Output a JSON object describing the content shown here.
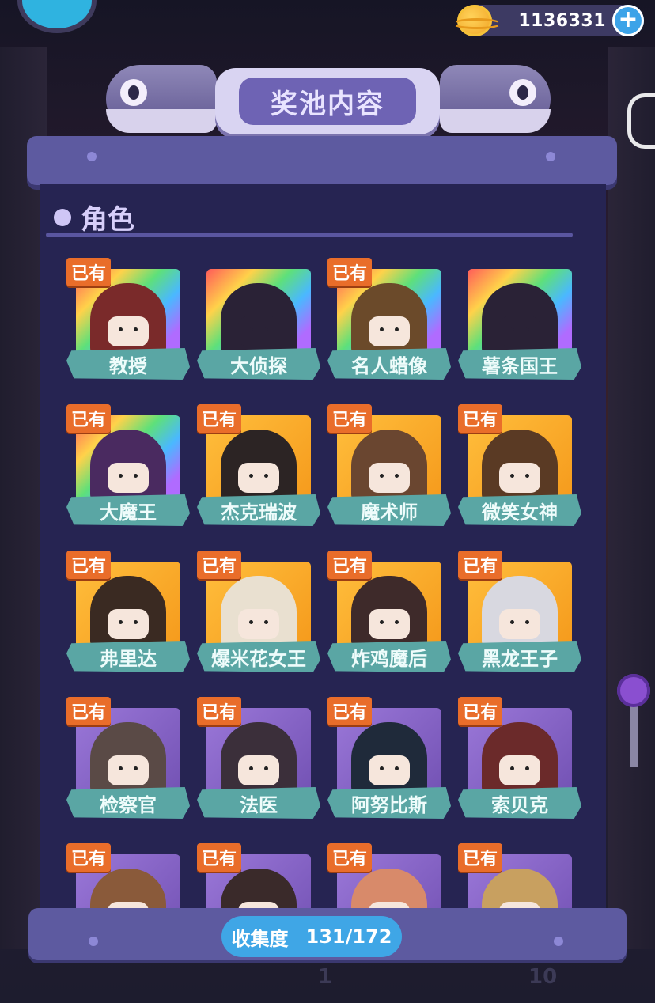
{
  "header": {
    "currency_value": "1136331",
    "plus_label": "+",
    "title": "奖池内容"
  },
  "section": {
    "title": "角色"
  },
  "owned_badge": "已有",
  "characters": [
    {
      "name": "教授",
      "rarity": "rainbow",
      "owned": true
    },
    {
      "name": "大侦探",
      "rarity": "rainbow",
      "owned": false
    },
    {
      "name": "名人蜡像",
      "rarity": "rainbow",
      "owned": true
    },
    {
      "name": "薯条国王",
      "rarity": "rainbow",
      "owned": false
    },
    {
      "name": "大魔王",
      "rarity": "rainbow",
      "owned": true
    },
    {
      "name": "杰克瑞波",
      "rarity": "gold",
      "owned": true
    },
    {
      "name": "魔术师",
      "rarity": "gold",
      "owned": true
    },
    {
      "name": "微笑女神",
      "rarity": "gold",
      "owned": true
    },
    {
      "name": "弗里达",
      "rarity": "gold",
      "owned": true
    },
    {
      "name": "爆米花女王",
      "rarity": "gold",
      "owned": true
    },
    {
      "name": "炸鸡魔后",
      "rarity": "gold",
      "owned": true
    },
    {
      "name": "黑龙王子",
      "rarity": "gold",
      "owned": true
    },
    {
      "name": "检察官",
      "rarity": "purple",
      "owned": true
    },
    {
      "name": "法医",
      "rarity": "purple",
      "owned": true
    },
    {
      "name": "阿努比斯",
      "rarity": "purple",
      "owned": true
    },
    {
      "name": "索贝克",
      "rarity": "purple",
      "owned": true
    },
    {
      "name": "",
      "rarity": "purple",
      "owned": true
    },
    {
      "name": "",
      "rarity": "purple",
      "owned": true
    },
    {
      "name": "",
      "rarity": "purple",
      "owned": true
    },
    {
      "name": "",
      "rarity": "purple",
      "owned": true
    }
  ],
  "footer": {
    "collection_label": "收集度",
    "collection_value": "131/172"
  },
  "background_numbers": [
    "1",
    "10"
  ],
  "colors": {
    "badge": "#e96d2a",
    "name_plate": "#5aa6a4",
    "panel": "#262452",
    "collection_pill": "#3fa6e6"
  }
}
